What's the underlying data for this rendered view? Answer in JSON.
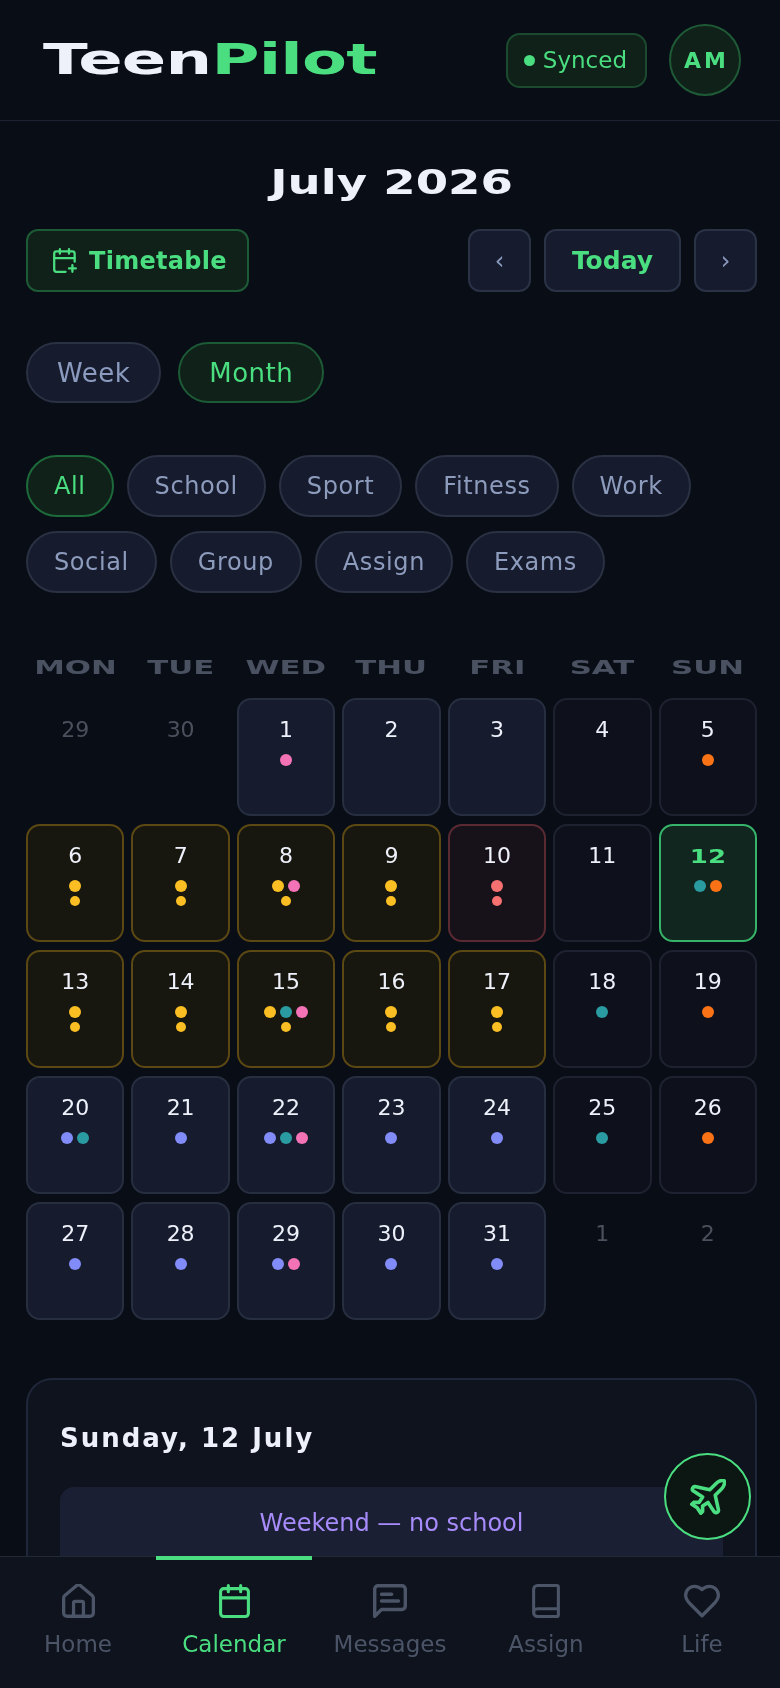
{
  "header": {
    "logo": {
      "first": "Teen",
      "second": "Pilot"
    },
    "sync_badge": {
      "label": "Synced"
    },
    "avatar": {
      "initials": "AM"
    }
  },
  "month_title": "July 2026",
  "toolbar": {
    "timetable_button": "Timetable",
    "prev_button": "‹",
    "today_button": "Today",
    "next_button": "›"
  },
  "view_toggle": [
    {
      "label": "Week",
      "selected": false
    },
    {
      "label": "Month",
      "selected": true
    }
  ],
  "filters": [
    {
      "label": "All",
      "selected": true
    },
    {
      "label": "School",
      "selected": false
    },
    {
      "label": "Sport",
      "selected": false
    },
    {
      "label": "Fitness",
      "selected": false
    },
    {
      "label": "Work",
      "selected": false
    },
    {
      "label": "Social",
      "selected": false
    },
    {
      "label": "Group",
      "selected": false
    },
    {
      "label": "Assign",
      "selected": false
    },
    {
      "label": "Exams",
      "selected": false
    }
  ],
  "calendar": {
    "weekdays": [
      "MON",
      "TUE",
      "WED",
      "THU",
      "FRI",
      "SAT",
      "SUN"
    ],
    "days": [
      {
        "label": "29",
        "kind": "outside",
        "selected": false
      },
      {
        "label": "30",
        "kind": "outside",
        "selected": false
      },
      {
        "label": "1",
        "kind": "weekday",
        "selected": false,
        "dots": [
          {
            "color": "#f472b6"
          }
        ]
      },
      {
        "label": "2",
        "kind": "weekday",
        "selected": false
      },
      {
        "label": "3",
        "kind": "weekday",
        "selected": false
      },
      {
        "label": "4",
        "kind": "weekend",
        "selected": false
      },
      {
        "label": "5",
        "kind": "weekend",
        "selected": false,
        "dots": [
          {
            "color": "#f97316"
          }
        ]
      },
      {
        "label": "6",
        "kind": "marked",
        "selected": false,
        "dots": [
          {
            "color": "#fbbf24"
          }
        ],
        "lower_dots": [
          {
            "color": "#fbbf24"
          }
        ]
      },
      {
        "label": "7",
        "kind": "marked",
        "selected": false,
        "dots": [
          {
            "color": "#fbbf24"
          }
        ],
        "lower_dots": [
          {
            "color": "#fbbf24"
          }
        ]
      },
      {
        "label": "8",
        "kind": "marked",
        "selected": false,
        "dots": [
          {
            "color": "#fbbf24"
          },
          {
            "color": "#f472b6"
          }
        ],
        "lower_dots": [
          {
            "color": "#fbbf24"
          }
        ]
      },
      {
        "label": "9",
        "kind": "marked",
        "selected": false,
        "dots": [
          {
            "color": "#fbbf24"
          }
        ],
        "lower_dots": [
          {
            "color": "#fbbf24"
          }
        ]
      },
      {
        "label": "10",
        "kind": "alert",
        "selected": false,
        "dots": [
          {
            "color": "#f87171"
          }
        ],
        "lower_dots": [
          {
            "color": "#f87171"
          }
        ]
      },
      {
        "label": "11",
        "kind": "weekend",
        "selected": false
      },
      {
        "label": "12",
        "kind": "weekend",
        "selected": true,
        "dots": [
          {
            "color": "#2a9ba1"
          },
          {
            "color": "#f97316"
          }
        ]
      },
      {
        "label": "13",
        "kind": "marked",
        "selected": false,
        "dots": [
          {
            "color": "#fbbf24"
          }
        ],
        "lower_dots": [
          {
            "color": "#fbbf24"
          }
        ]
      },
      {
        "label": "14",
        "kind": "marked",
        "selected": false,
        "dots": [
          {
            "color": "#fbbf24"
          }
        ],
        "lower_dots": [
          {
            "color": "#fbbf24"
          }
        ]
      },
      {
        "label": "15",
        "kind": "marked",
        "selected": false,
        "dots": [
          {
            "color": "#fbbf24"
          },
          {
            "color": "#2a9ba1"
          },
          {
            "color": "#f472b6"
          }
        ],
        "lower_dots": [
          {
            "color": "#fbbf24"
          }
        ]
      },
      {
        "label": "16",
        "kind": "marked",
        "selected": false,
        "dots": [
          {
            "color": "#fbbf24"
          }
        ],
        "lower_dots": [
          {
            "color": "#fbbf24"
          }
        ]
      },
      {
        "label": "17",
        "kind": "marked",
        "selected": false,
        "dots": [
          {
            "color": "#fbbf24"
          }
        ],
        "lower_dots": [
          {
            "color": "#fbbf24"
          }
        ]
      },
      {
        "label": "18",
        "kind": "weekend",
        "selected": false,
        "dots": [
          {
            "color": "#2a9ba1"
          }
        ]
      },
      {
        "label": "19",
        "kind": "weekend",
        "selected": false,
        "dots": [
          {
            "color": "#f97316"
          }
        ]
      },
      {
        "label": "20",
        "kind": "weekday",
        "selected": false,
        "dots": [
          {
            "color": "#818cf8"
          },
          {
            "color": "#2a9ba1"
          }
        ]
      },
      {
        "label": "21",
        "kind": "weekday",
        "selected": false,
        "dots": [
          {
            "color": "#818cf8"
          }
        ]
      },
      {
        "label": "22",
        "kind": "weekday",
        "selected": false,
        "dots": [
          {
            "color": "#818cf8"
          },
          {
            "color": "#2a9ba1"
          },
          {
            "color": "#f472b6"
          }
        ]
      },
      {
        "label": "23",
        "kind": "weekday",
        "selected": false,
        "dots": [
          {
            "color": "#818cf8"
          }
        ]
      },
      {
        "label": "24",
        "kind": "weekday",
        "selected": false,
        "dots": [
          {
            "color": "#818cf8"
          }
        ]
      },
      {
        "label": "25",
        "kind": "weekend",
        "selected": false,
        "dots": [
          {
            "color": "#2a9ba1"
          }
        ]
      },
      {
        "label": "26",
        "kind": "weekend",
        "selected": false,
        "dots": [
          {
            "color": "#f97316"
          }
        ]
      },
      {
        "label": "27",
        "kind": "weekday",
        "selected": false,
        "dots": [
          {
            "color": "#818cf8"
          }
        ]
      },
      {
        "label": "28",
        "kind": "weekday",
        "selected": false,
        "dots": [
          {
            "color": "#818cf8"
          }
        ]
      },
      {
        "label": "29",
        "kind": "weekday",
        "selected": false,
        "dots": [
          {
            "color": "#818cf8"
          },
          {
            "color": "#f472b6"
          }
        ]
      },
      {
        "label": "30",
        "kind": "weekday",
        "selected": false,
        "dots": [
          {
            "color": "#818cf8"
          }
        ]
      },
      {
        "label": "31",
        "kind": "weekday",
        "selected": false,
        "dots": [
          {
            "color": "#818cf8"
          }
        ]
      },
      {
        "label": "1",
        "kind": "outside",
        "selected": false
      },
      {
        "label": "2",
        "kind": "outside",
        "selected": false
      }
    ]
  },
  "day_detail": {
    "title": "Sunday, 12 July",
    "note": "Weekend — no school"
  },
  "bottom_nav": [
    {
      "label": "Home",
      "selected": false
    },
    {
      "label": "Calendar",
      "selected": true
    },
    {
      "label": "Messages",
      "selected": false
    },
    {
      "label": "Assign",
      "selected": false
    },
    {
      "label": "Life",
      "selected": false
    }
  ]
}
